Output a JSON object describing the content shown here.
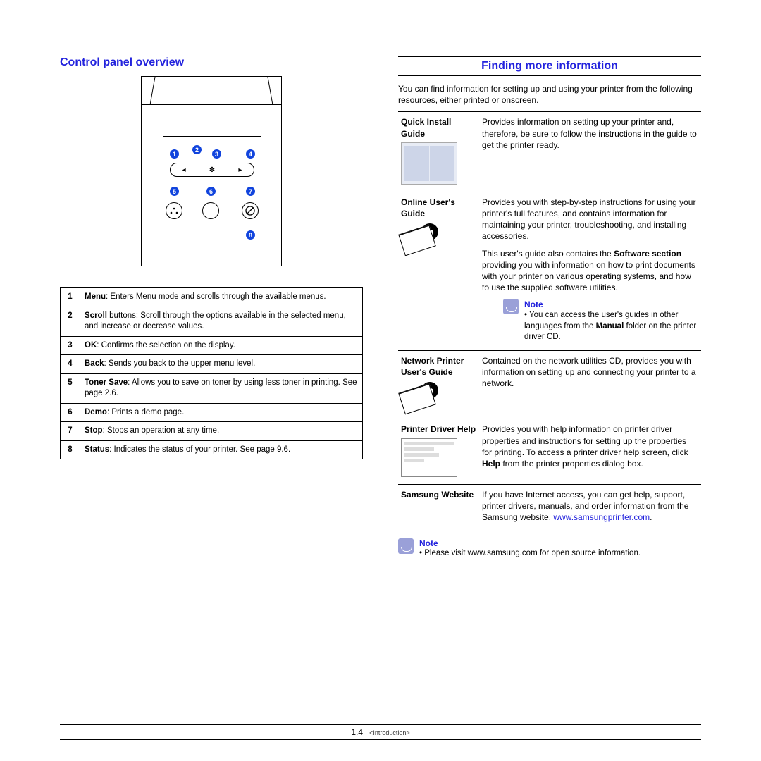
{
  "left": {
    "heading": "Control panel overview",
    "callouts": [
      "1",
      "2",
      "3",
      "4",
      "5",
      "6",
      "7",
      "8"
    ],
    "rows": [
      {
        "n": "1",
        "term": "Menu",
        "text": ": Enters Menu mode and scrolls through the available menus."
      },
      {
        "n": "2",
        "term": "Scroll",
        "text": " buttons: Scroll through the options available in the selected menu, and increase or decrease values."
      },
      {
        "n": "3",
        "term": "OK",
        "text": ": Confirms the selection on the display."
      },
      {
        "n": "4",
        "term": "Back",
        "text": ": Sends you back to the upper menu level."
      },
      {
        "n": "5",
        "term": "Toner Save",
        "text": ": Allows you to save on toner by using less toner in printing. See page 2.6."
      },
      {
        "n": "6",
        "term": "Demo",
        "text": ": Prints a demo page."
      },
      {
        "n": "7",
        "term": "Stop",
        "text": ": Stops an operation at any time."
      },
      {
        "n": "8",
        "term": "Status",
        "text": ": Indicates the status of your printer. See page 9.6."
      }
    ]
  },
  "right": {
    "heading": "Finding more information",
    "intro": "You can find information for setting up and using your printer from the following resources, either printed or onscreen.",
    "resources": {
      "qig": {
        "label": "Quick Install Guide",
        "text": "Provides information on setting up your printer and, therefore, be sure to follow the instructions in the guide to get the printer ready."
      },
      "online": {
        "label": "Online User's Guide",
        "p1": "Provides you with step-by-step instructions for using your printer's full features, and contains information for maintaining your printer, troubleshooting, and installing accessories.",
        "p2a": "This user's guide also contains the ",
        "p2b": "Software section",
        "p2c": " providing you with information on how to print documents with your printer on various operating systems, and how to use the supplied software utilities.",
        "note_title": "Note",
        "note_a": "You can access the user's guides in other languages from the ",
        "note_b": "Manual",
        "note_c": " folder on the printer driver CD."
      },
      "net": {
        "label": "Network Printer User's Guide",
        "text": "Contained on the network utilities CD, provides you with information on setting up and connecting your printer to a network."
      },
      "help": {
        "label": "Printer Driver Help",
        "a": "Provides you with help information on printer driver properties and instructions for setting up the properties for printing. To access a printer driver help screen, click ",
        "b": "Help",
        "c": " from the printer properties dialog box."
      },
      "web": {
        "label": "Samsung Website",
        "text": "If you have Internet access, you can get help, support, printer drivers, manuals, and order information from the Samsung website, ",
        "url": "www.samsungprinter.com",
        "dot": "."
      }
    },
    "bottom_note": {
      "title": "Note",
      "text": "Please visit www.samsung.com for open source information."
    }
  },
  "footer": {
    "page": "1.4",
    "chapter": "<Introduction>"
  }
}
